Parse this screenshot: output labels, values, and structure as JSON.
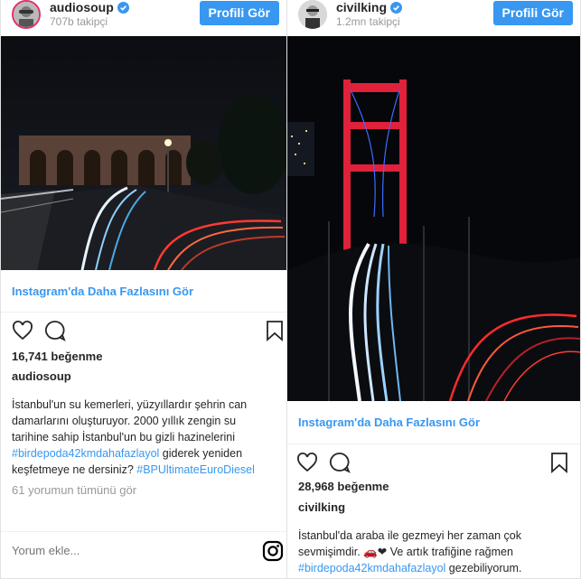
{
  "colors": {
    "accent": "#3897f0",
    "muted": "#999999",
    "text": "#262626",
    "verified": "#3897f0"
  },
  "posts": [
    {
      "username": "audiosoup",
      "followers": "707b takipçi",
      "profile_button": "Profili Gör",
      "more_link": "Instagram'da Daha Fazlasını Gör",
      "likes": "16,741 beğenme",
      "owner": "audiosoup",
      "caption_text": "İstanbul'un su kemerleri, yüzyıllardır şehrin can damarlarını oluşturuyor. 2000 yıllık zengin su tarihine sahip İstanbul'un bu gizli hazinelerini ",
      "caption_hashtag1": "#birdepoda42kmdahafazlayol",
      "caption_text2": " giderek yeniden keşfetmeye ne dersiniz? ",
      "caption_hashtag2": "#BPUltimateEuroDiesel",
      "comments_link": "61 yorumun tümünü gör",
      "comment_placeholder": "Yorum ekle...",
      "icons": [
        "heart-icon",
        "comment-icon",
        "bookmark-icon",
        "instagram-logo-icon"
      ]
    },
    {
      "username": "civilking",
      "followers": "1.2mn takipçi",
      "profile_button": "Profili Gör",
      "more_link": "Instagram'da Daha Fazlasını Gör",
      "likes": "28,968 beğenme",
      "owner": "civilking",
      "caption_text": "İstanbul'da araba ile gezmeyi her zaman çok sevmişimdir. 🚗❤ Ve artık trafiğine rağmen ",
      "caption_hashtag1": "#birdepoda42kmdahafazlayol",
      "caption_text2": " gezebiliyorum.",
      "icons": [
        "heart-icon",
        "comment-icon",
        "bookmark-icon"
      ]
    }
  ]
}
